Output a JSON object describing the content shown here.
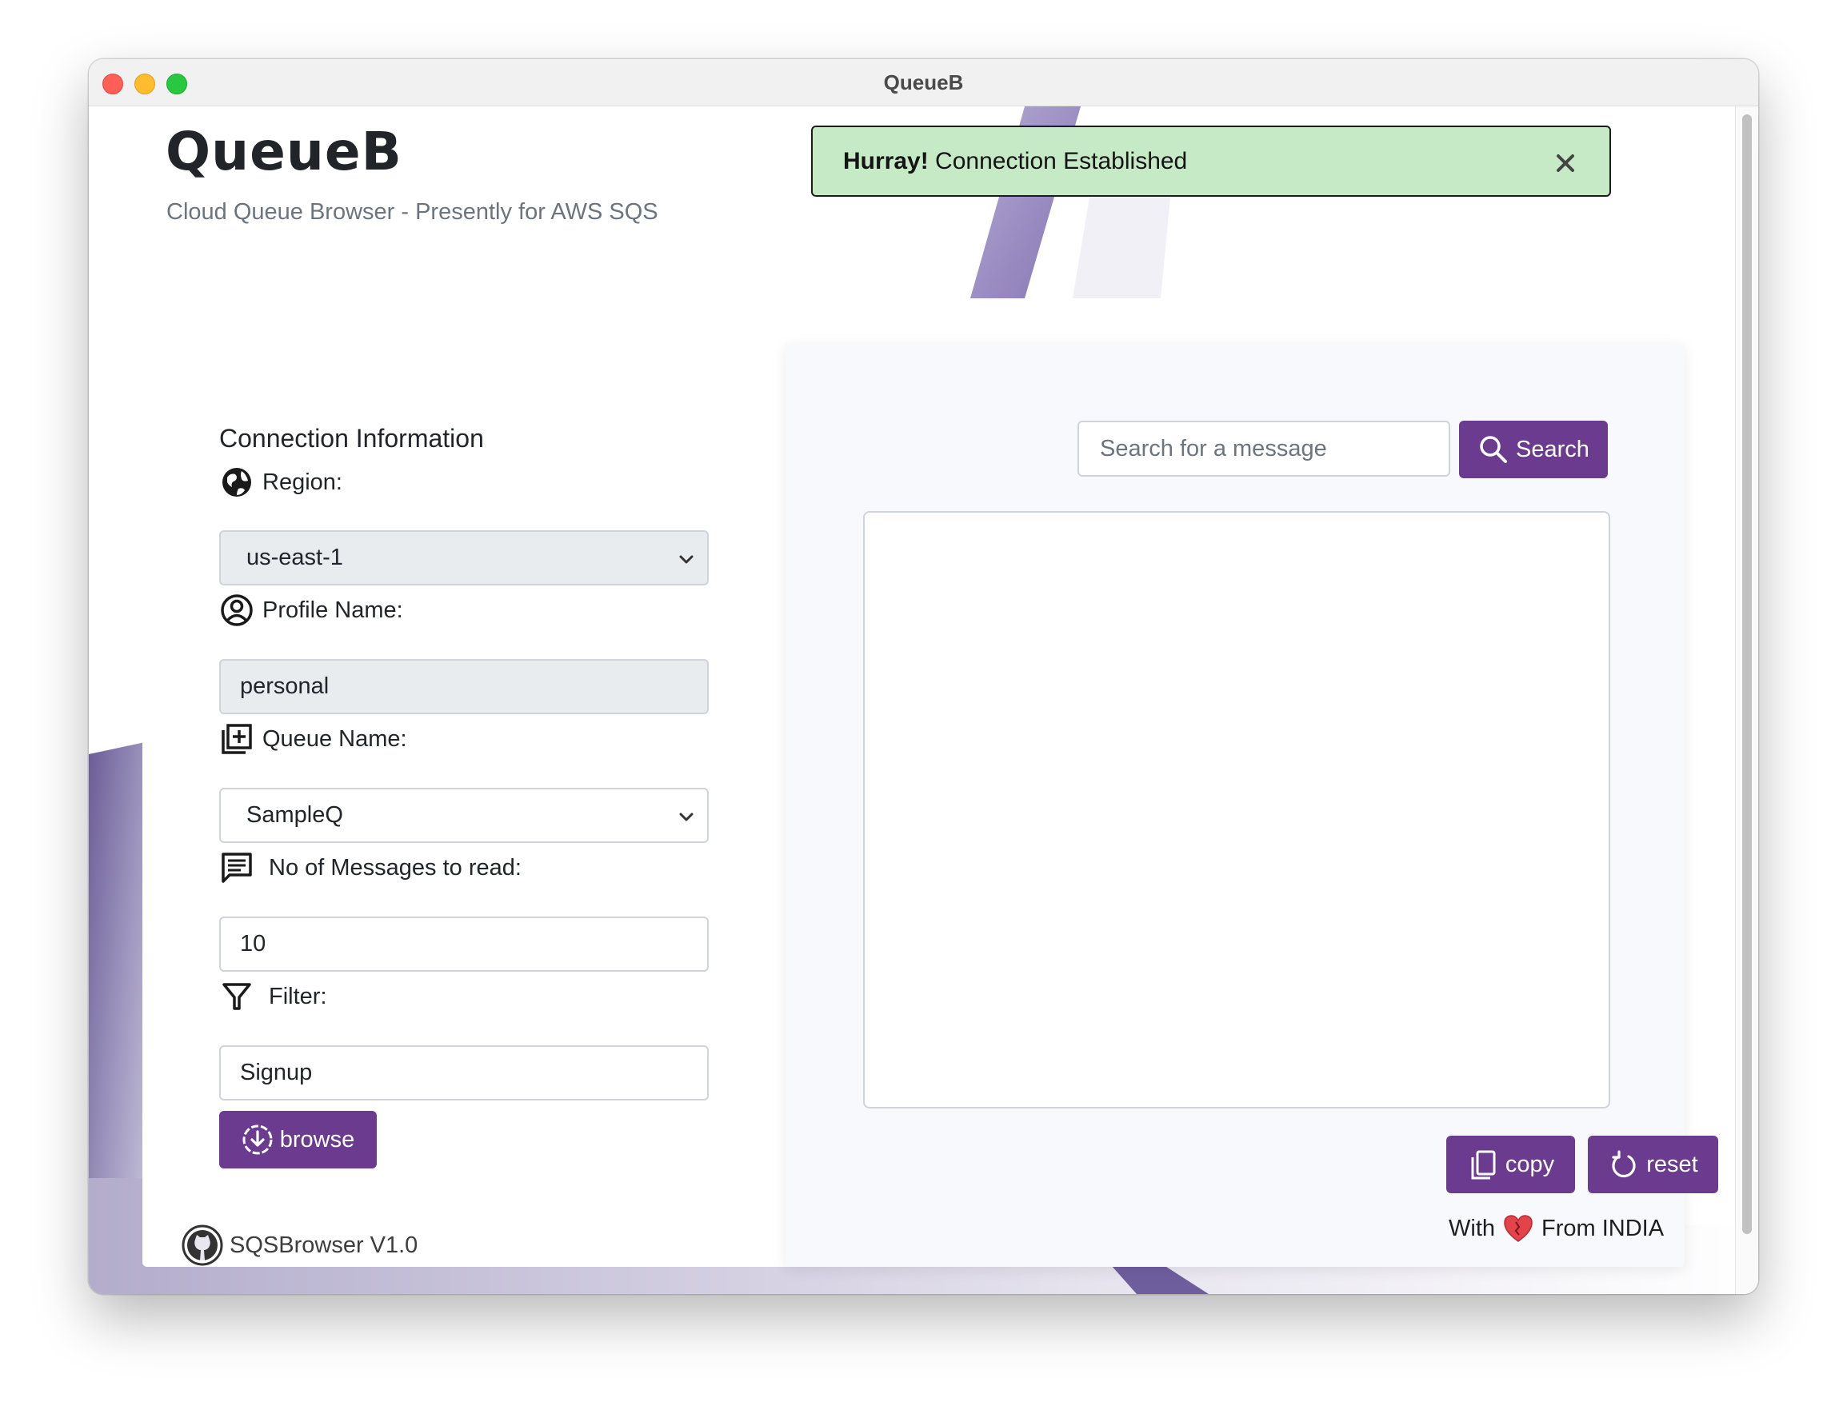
{
  "window": {
    "title": "QueueB"
  },
  "header": {
    "app_title": "QueueB",
    "subtitle": "Cloud Queue Browser - Presently for AWS SQS"
  },
  "alert": {
    "strong": "Hurray!",
    "message": " Connection Established",
    "close_icon": "close-icon"
  },
  "connection": {
    "section_title": "Connection Information",
    "region": {
      "label": "Region:",
      "icon": "globe-icon",
      "value": "us-east-1"
    },
    "profile": {
      "label": "Profile Name:",
      "icon": "user-circle-icon",
      "value": "personal"
    },
    "queue": {
      "label": "Queue Name:",
      "icon": "add-to-queue-icon",
      "value": "SampleQ"
    },
    "messages": {
      "label": "No of Messages to read:",
      "icon": "chat-lines-icon",
      "value": "10"
    },
    "filter": {
      "label": "Filter:",
      "icon": "funnel-icon",
      "value": "Signup"
    },
    "browse_button": {
      "label": "browse",
      "icon": "download-circle-icon"
    }
  },
  "results": {
    "search_placeholder": "Search for a message",
    "search_button": {
      "label": "Search",
      "icon": "search-icon"
    },
    "output_text": "",
    "copy_button": {
      "label": "copy",
      "icon": "copy-icon"
    },
    "reset_button": {
      "label": "reset",
      "icon": "reset-icon"
    }
  },
  "footer": {
    "left_text": "SQSBrowser V1.0",
    "left_icon": "github-icon",
    "right_prefix": "With",
    "right_icon": "heart-icon",
    "right_suffix": "From INDIA"
  },
  "colors": {
    "accent": "#6a3b8f",
    "alert_bg": "#c6e9c6",
    "panel_right_bg": "#f8f9fd",
    "input_disabled_bg": "#e9ecef"
  }
}
